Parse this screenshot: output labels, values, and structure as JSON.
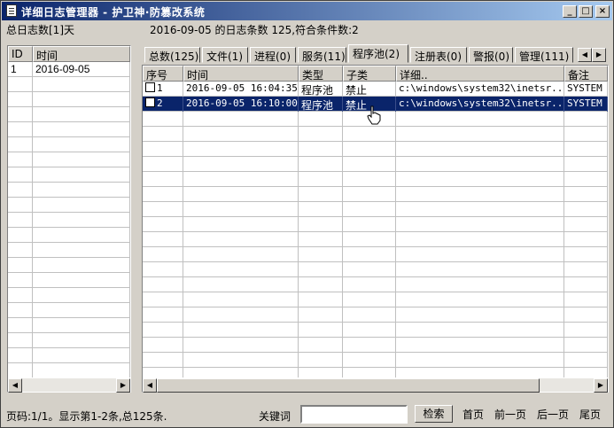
{
  "window": {
    "title": "详细日志管理器 - 护卫神·防篡改系统"
  },
  "title_buttons": {
    "minimize": "_",
    "maximize": "□",
    "close": "×"
  },
  "summary": {
    "total_days": "总日志数[1]天",
    "date_info": "2016-09-05 的日志条数 125,符合条件数:2"
  },
  "left_table": {
    "headers": [
      "ID",
      "时间"
    ],
    "rows": [
      {
        "id": "1",
        "time": "2016-09-05"
      }
    ]
  },
  "tabs": [
    {
      "label": "总数(125)",
      "active": false
    },
    {
      "label": "文件(1)",
      "active": false
    },
    {
      "label": "进程(0)",
      "active": false
    },
    {
      "label": "服务(11)",
      "active": false
    },
    {
      "label": "程序池(2)",
      "active": true
    },
    {
      "label": "注册表(0)",
      "active": false
    },
    {
      "label": "警报(0)",
      "active": false
    },
    {
      "label": "管理(111)",
      "active": false
    }
  ],
  "log_table": {
    "headers": [
      "序号",
      "时间",
      "类型",
      "子类",
      "详细..",
      "备注"
    ],
    "rows": [
      {
        "seq": "1",
        "time": "2016-09-05 16:04:35",
        "type": "程序池",
        "subtype": "禁止",
        "detail": "c:\\windows\\system32\\inetsr...",
        "note": "SYSTEM",
        "selected": false
      },
      {
        "seq": "2",
        "time": "2016-09-05 16:10:00",
        "type": "程序池",
        "subtype": "禁止",
        "detail": "c:\\windows\\system32\\inetsr...",
        "note": "SYSTEM",
        "selected": true
      }
    ]
  },
  "footer": {
    "page_info": "页码:1/1。显示第1-2条,总125条.",
    "keyword_label": "关键词",
    "keyword_value": "",
    "search_button": "检索",
    "first_page": "首页",
    "prev_page": "前一页",
    "next_page": "后一页",
    "last_page": "尾页"
  },
  "colors": {
    "selection": "#0a246a",
    "title_start": "#0a246a",
    "title_end": "#a6caf0"
  }
}
